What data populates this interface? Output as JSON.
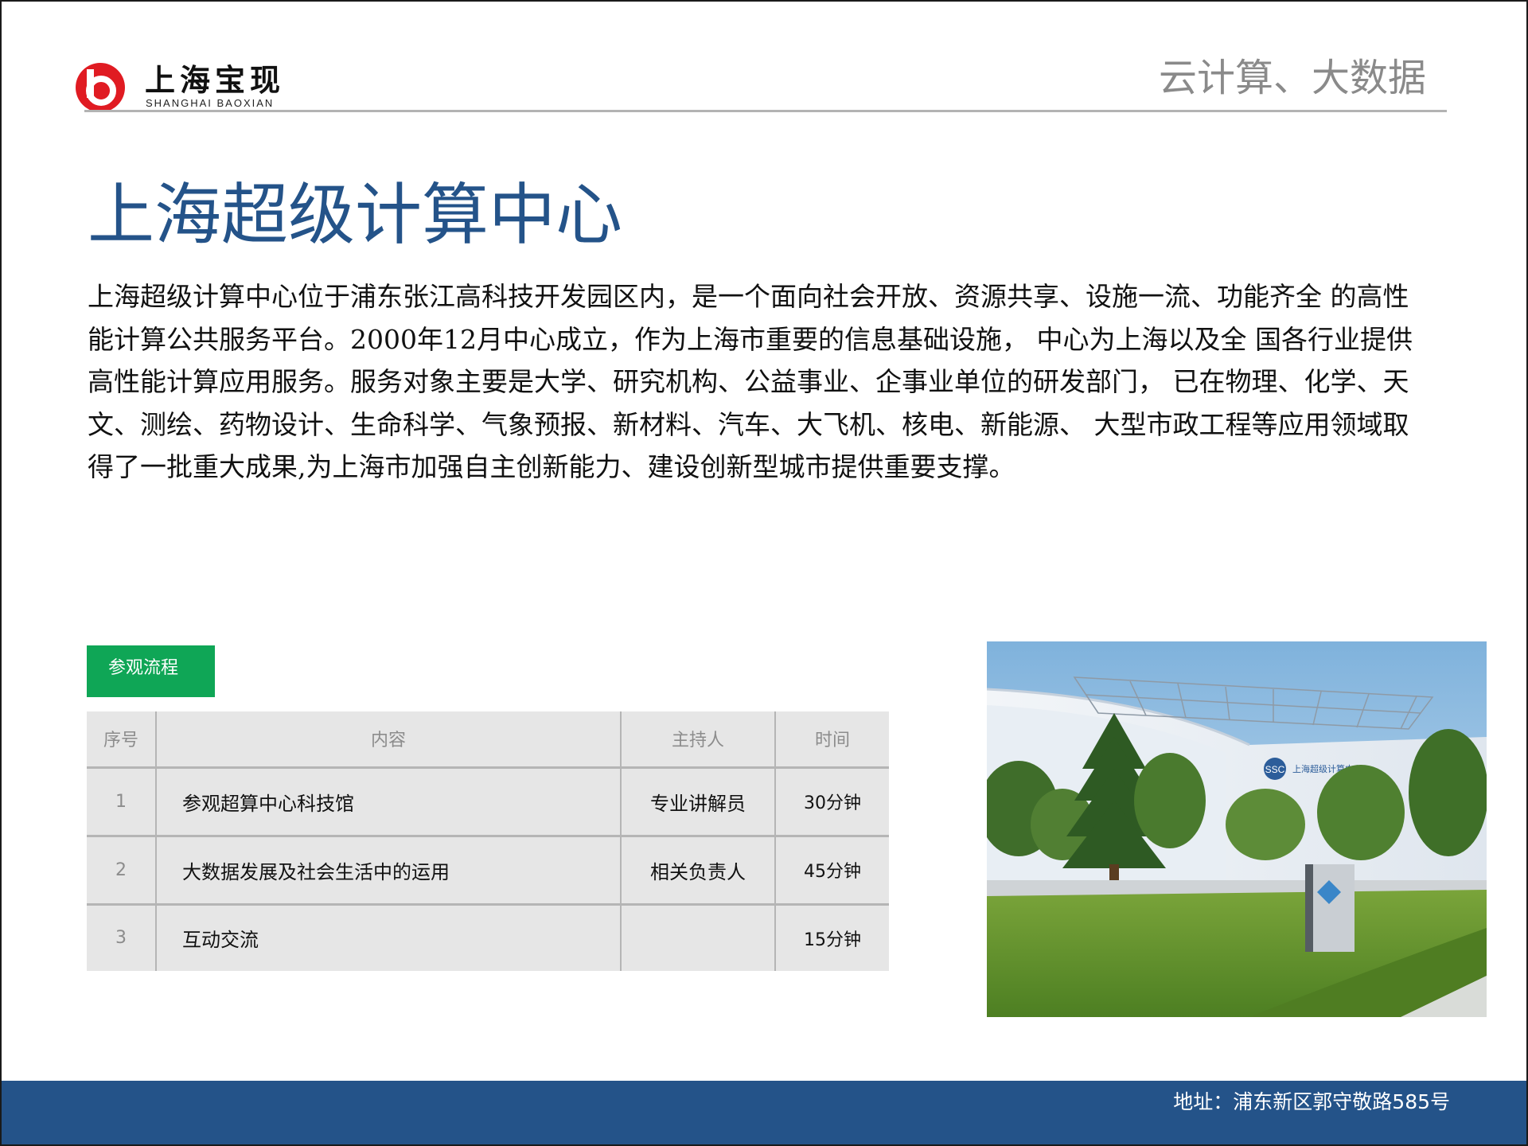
{
  "header": {
    "brand_cn": "上海宝现",
    "brand_en": "SHANGHAI BAOXIAN",
    "section_title": "云计算、大数据"
  },
  "main": {
    "title": "上海超级计算中心",
    "intro": "上海超级计算中心位于浦东张江高科技开发园区内，是一个面向社会开放、资源共享、设施一流、功能齐全 的高性能计算公共服务平台。2000年12月中心成立，作为上海市重要的信息基础设施， 中心为上海以及全 国各行业提供高性能计算应用服务。服务对象主要是大学、研究机构、公益事业、企事业单位的研发部门， 已在物理、化学、天文、测绘、药物设计、生命科学、气象预报、新材料、汽车、大飞机、核电、新能源、 大型市政工程等应用领域取得了一批重大成果,为上海市加强自主创新能力、建设创新型城市提供重要支撑。",
    "tag": "参观流程"
  },
  "table": {
    "headers": [
      "序号",
      "内容",
      "主持人",
      "时间"
    ],
    "rows": [
      {
        "no": "1",
        "content": "参观超算中心科技馆",
        "host": "专业讲解员",
        "time": "30分钟"
      },
      {
        "no": "2",
        "content": "大数据发展及社会生活中的运用",
        "host": "相关负责人",
        "time": "45分钟"
      },
      {
        "no": "3",
        "content": "互动交流",
        "host": "",
        "time": "15分钟"
      }
    ]
  },
  "photo": {
    "sign_text": "上海超级计算中心"
  },
  "footer": {
    "address": "地址：浦东新区郭守敬路585号"
  },
  "colors": {
    "brand_red": "#e01b22",
    "title_blue": "#245389",
    "tag_green": "#0fa656",
    "table_bg": "#e6e6e6",
    "footer_blue": "#245389"
  }
}
